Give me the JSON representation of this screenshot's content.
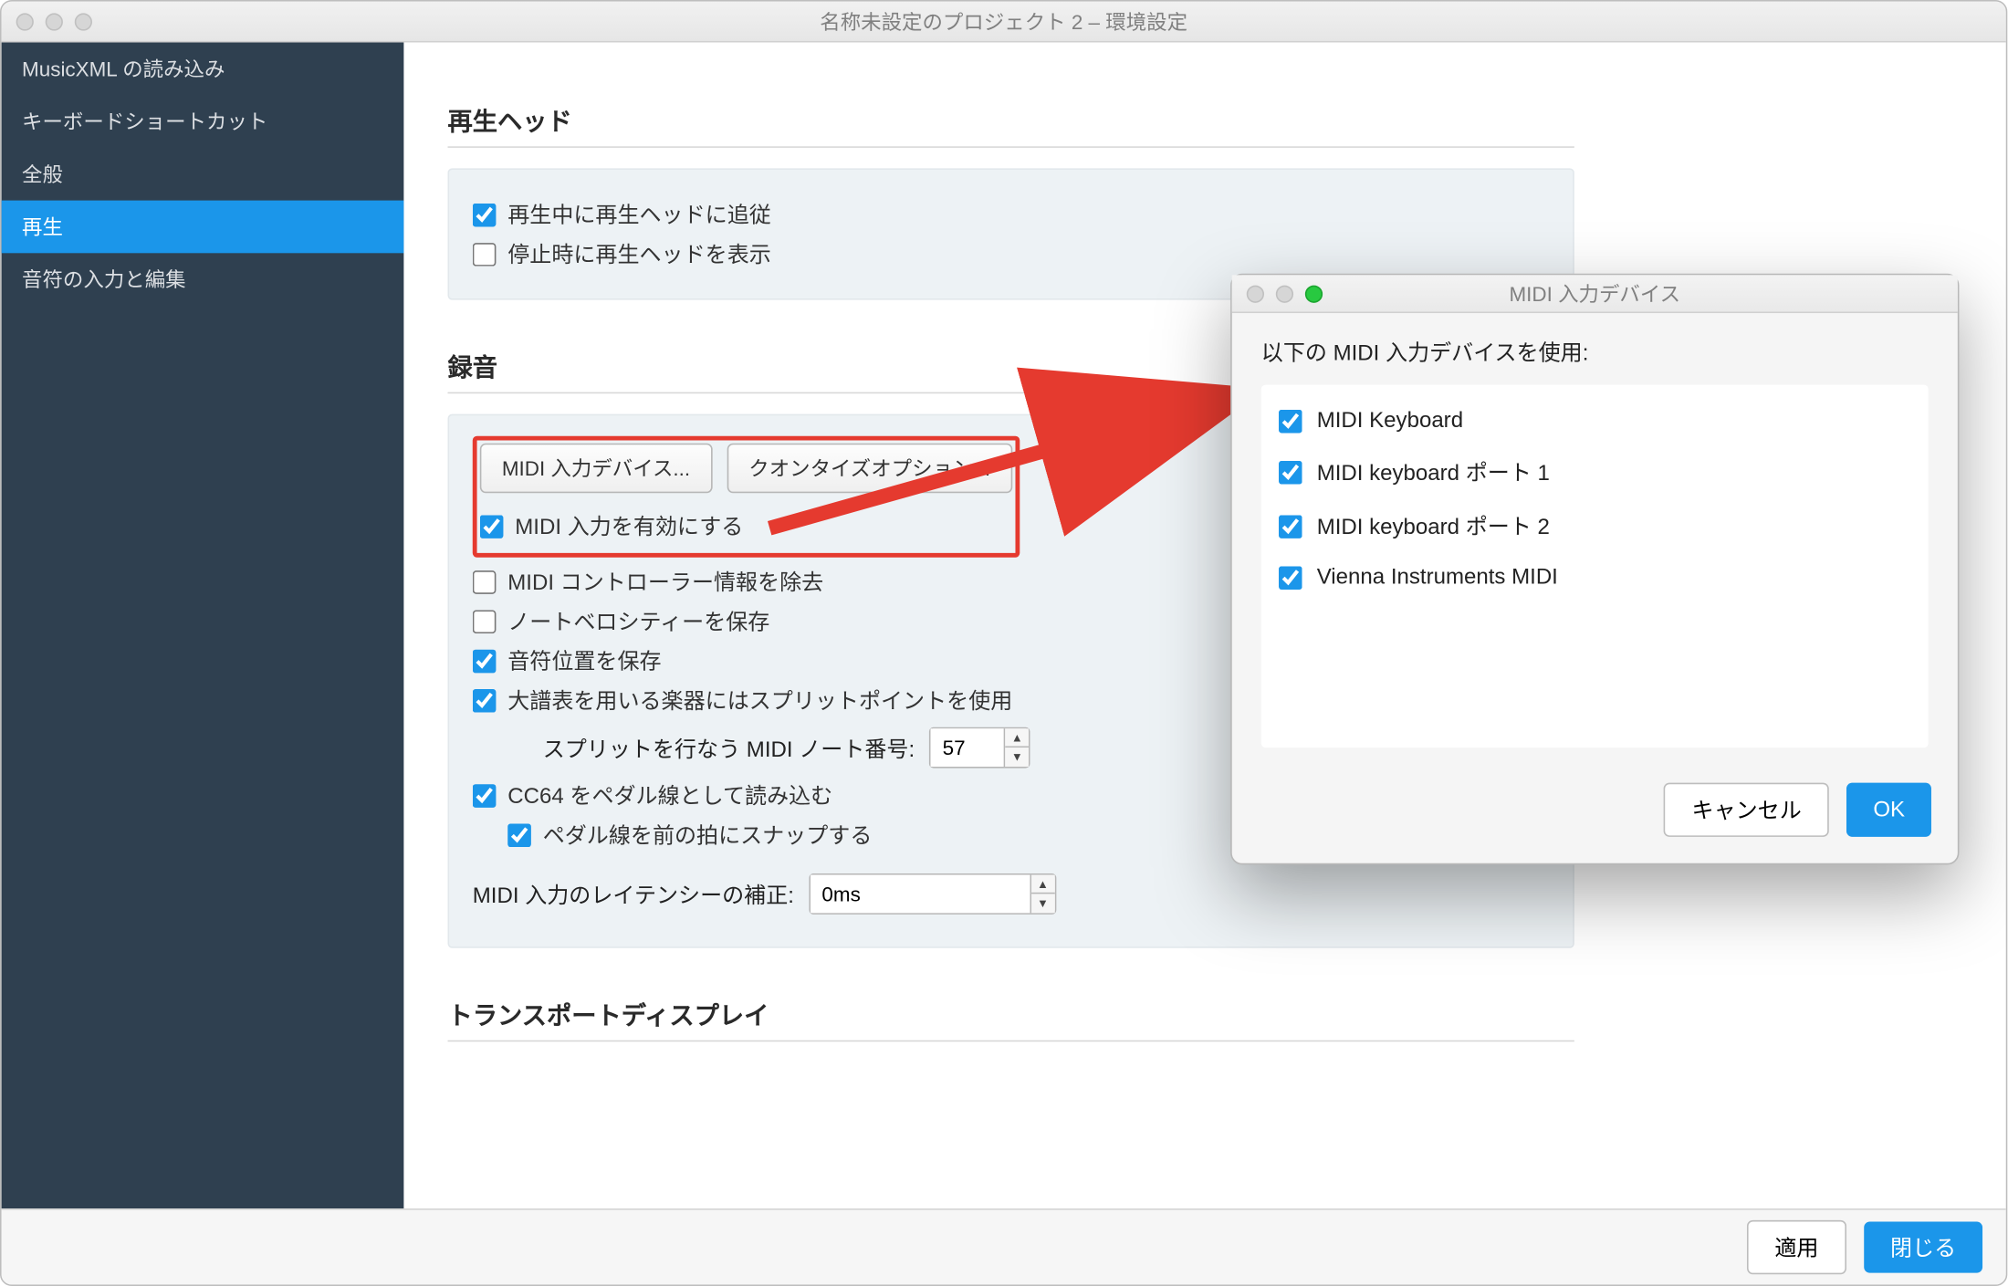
{
  "window": {
    "title": "名称未設定のプロジェクト 2 – 環境設定"
  },
  "sidebar": {
    "items": [
      {
        "label": "MusicXML の読み込み"
      },
      {
        "label": "キーボードショートカット"
      },
      {
        "label": "全般"
      },
      {
        "label": "再生"
      },
      {
        "label": "音符の入力と編集"
      }
    ]
  },
  "sections": {
    "playhead_title": "再生ヘッド",
    "record_title": "録音",
    "transport_title": "トランスポートディスプレイ"
  },
  "playhead": {
    "follow_label": "再生中に再生ヘッドに追従",
    "show_on_stop_label": "停止時に再生ヘッドを表示"
  },
  "record": {
    "midi_devices_btn": "MIDI 入力デバイス...",
    "quantize_btn": "クオンタイズオプション...",
    "enable_midi_label": "MIDI 入力を有効にする",
    "remove_cc_label": "MIDI コントローラー情報を除去",
    "preserve_velocity_label": "ノートベロシティーを保存",
    "preserve_position_label": "音符位置を保存",
    "splitpoint_label": "大譜表を用いる楽器にはスプリットポイントを使用",
    "split_note_label": "スプリットを行なう MIDI ノート番号:",
    "split_note_value": "57",
    "cc64_label": "CC64 をペダル線として読み込む",
    "snap_pedal_label": "ペダル線を前の拍にスナップする",
    "latency_label": "MIDI 入力のレイテンシーの補正:",
    "latency_value": "0ms"
  },
  "footer": {
    "apply": "適用",
    "close": "閉じる"
  },
  "dialog": {
    "title": "MIDI 入力デバイス",
    "prompt": "以下の MIDI 入力デバイスを使用:",
    "devices": [
      "MIDI Keyboard",
      "MIDI keyboard ポート 1",
      "MIDI keyboard ポート 2",
      "Vienna Instruments MIDI"
    ],
    "cancel": "キャンセル",
    "ok": "OK"
  }
}
